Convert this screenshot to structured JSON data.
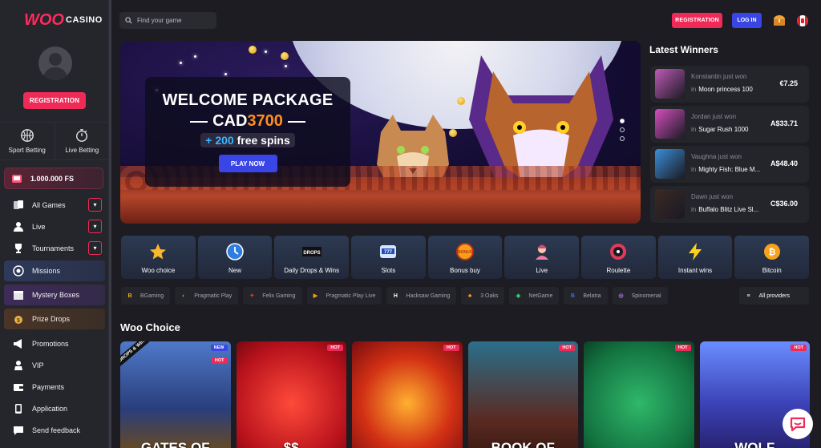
{
  "brand": {
    "woo": "WOO",
    "casino": "CASINO"
  },
  "sidebar": {
    "registration_label": "REGISTRATION",
    "sports": [
      {
        "label": "Sport Betting",
        "icon": "basketball-icon"
      },
      {
        "label": "Live Betting",
        "icon": "stopwatch-icon"
      }
    ],
    "free_spins": "1.000.000 FS",
    "menu": [
      {
        "label": "All Games",
        "icon": "cards-icon",
        "expandable": true
      },
      {
        "label": "Live",
        "icon": "dealer-icon",
        "expandable": true
      },
      {
        "label": "Tournaments",
        "icon": "trophy-icon",
        "expandable": true
      },
      {
        "label": "Missions",
        "icon": "target-icon"
      },
      {
        "label": "Mystery Boxes",
        "icon": "box-icon"
      },
      {
        "label": "Prize Drops",
        "icon": "gift-icon"
      },
      {
        "label": "Promotions",
        "icon": "megaphone-icon"
      },
      {
        "label": "VIP",
        "icon": "vip-icon"
      },
      {
        "label": "Payments",
        "icon": "wallet-icon"
      },
      {
        "label": "Application",
        "icon": "phone-icon"
      },
      {
        "label": "Send feedback",
        "icon": "chat-icon"
      }
    ]
  },
  "header": {
    "search_placeholder": "Find your game",
    "registration_label": "REGISTRATION",
    "login_label": "LOG IN"
  },
  "hero": {
    "line1": "WELCOME PACKAGE",
    "currency": "CAD",
    "amount": "3700",
    "plus": "+ 200",
    "spins": "free spins",
    "cta": "PLAY NOW"
  },
  "latest_winners": {
    "title": "Latest Winners",
    "in_label": "in",
    "rows": [
      {
        "who": "Konstantin just won",
        "game": "Moon princess 100",
        "amount": "€7.25",
        "color": "#c05ab8"
      },
      {
        "who": "Jordan just won",
        "game": "Sugar Rush 1000",
        "amount": "A$33.71",
        "color": "#d54fc0"
      },
      {
        "who": "Vaughna just won",
        "game": "Mighty Fish: Blue M...",
        "amount": "A$48.40",
        "color": "#3a8fd8"
      },
      {
        "who": "Dawn just won",
        "game": "Buffalo Blitz Live Sl...",
        "amount": "C$36.00",
        "color": "#3b2a26"
      }
    ]
  },
  "categories": [
    {
      "label": "Woo choice",
      "icon": "star-icon"
    },
    {
      "label": "New",
      "icon": "clock-icon"
    },
    {
      "label": "Daily Drops & Wins",
      "icon": "drops-wins-icon"
    },
    {
      "label": "Slots",
      "icon": "slot-machine-icon"
    },
    {
      "label": "Bonus buy",
      "icon": "bonus-icon"
    },
    {
      "label": "Live",
      "icon": "dealer-icon"
    },
    {
      "label": "Roulette",
      "icon": "roulette-icon"
    },
    {
      "label": "Instant wins",
      "icon": "lightning-icon"
    },
    {
      "label": "Bitcoin",
      "icon": "bitcoin-icon"
    }
  ],
  "providers": [
    {
      "label": "BGaming",
      "mark": "B",
      "color": "#f2b21a"
    },
    {
      "label": "Pragmatic Play",
      "mark": "◐",
      "color": "#f27a1a"
    },
    {
      "label": "Felix Gaming",
      "mark": "✦",
      "color": "#e23a3a"
    },
    {
      "label": "Pragmatic Play Live",
      "mark": "▶",
      "color": "#f2a21a"
    },
    {
      "label": "Hacksaw Gaming",
      "mark": "H",
      "color": "#ffffff"
    },
    {
      "label": "3 Oaks",
      "mark": "♣",
      "color": "#f2a21a"
    },
    {
      "label": "NetGame",
      "mark": "◆",
      "color": "#2ec46e"
    },
    {
      "label": "Belatra",
      "mark": "B",
      "color": "#3a6cff"
    },
    {
      "label": "Spinomenal",
      "mark": "◎",
      "color": "#b07aff"
    },
    {
      "label": "All providers",
      "mark": "≡",
      "color": "#ffffff"
    }
  ],
  "woo_choice": {
    "title": "Woo Choice",
    "drops_badge": "DROPS & WINS",
    "games": [
      {
        "title": "GATES OF",
        "tags": [
          "NEW",
          "HOT"
        ]
      },
      {
        "title": "$$",
        "tags": [
          "HOT"
        ]
      },
      {
        "title": "",
        "tags": [
          "HOT"
        ]
      },
      {
        "title": "BOOK OF",
        "tags": [
          "HOT"
        ]
      },
      {
        "title": "",
        "tags": [
          "HOT"
        ]
      },
      {
        "title": "WOLF",
        "tags": [
          "HOT"
        ]
      }
    ]
  }
}
